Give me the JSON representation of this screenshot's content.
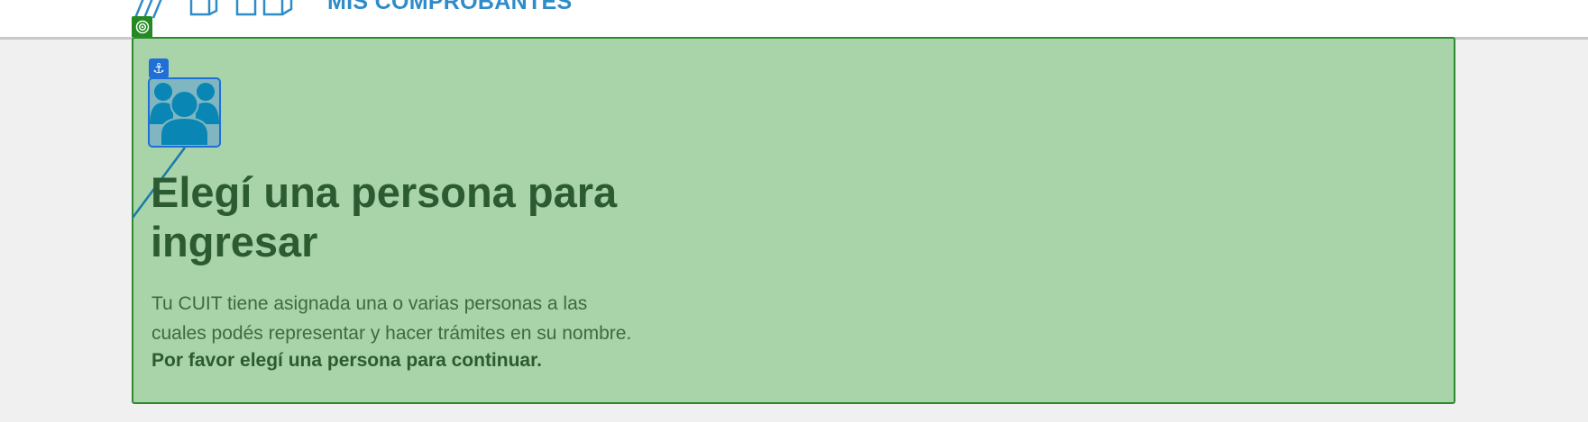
{
  "header": {
    "app_title": "MIS COMPROBANTES",
    "logo_icon": "afip-logo-icon"
  },
  "selection": {
    "target_icon": "target-icon",
    "anchor_icon": "anchor-icon",
    "anchor_glyph": "⚓",
    "highlight_color": "#a9d3a9",
    "border_color": "#2e8a2e",
    "badge_color": "#238a23",
    "anchor_color": "#1f6fd6"
  },
  "main": {
    "avatar_icon": "group-users-icon",
    "heading": "Elegí una persona para ingresar",
    "description_line1": "Tu CUIT tiene asignada una o varias personas a las",
    "description_line2": "cuales podés representar y hacer trámites en su nombre.",
    "description_strong": "Por favor elegí una persona para continuar."
  },
  "colors": {
    "brand_blue": "#2e8cc8",
    "heading_green": "#2c5b32",
    "avatar_blue": "#0a86b4"
  }
}
